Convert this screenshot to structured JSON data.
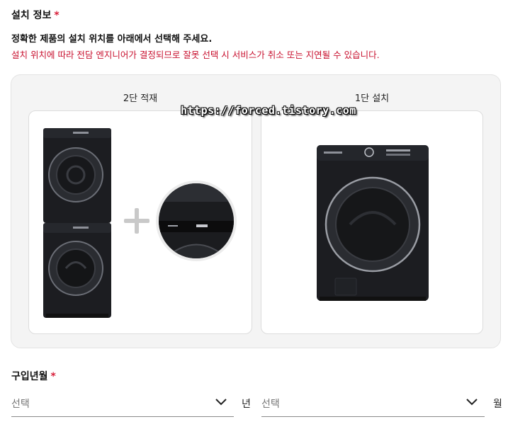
{
  "install": {
    "title": "설치 정보",
    "required_mark": "*",
    "question": "정확한 제품의 설치 위치를 아래에서 선택해 주세요.",
    "warning": "설치 위치에 따라 전담 엔지니어가 결정되므로 잘못 선택 시 서비스가 취소 또는 지연될 수 있습니다.",
    "options": [
      {
        "label": "2단 적재",
        "image": "stacked-washer-dryer-with-stacking-kit"
      },
      {
        "label": "1단 설치",
        "image": "single-front-load-washer"
      }
    ]
  },
  "watermark": "https://forced.tistory.com",
  "purchase": {
    "title": "구입년월",
    "required_mark": "*",
    "year_placeholder": "선택",
    "year_unit": "년",
    "month_placeholder": "선택",
    "month_unit": "월"
  },
  "colors": {
    "accent": "#d81f3a",
    "warning": "#c8102e",
    "panel": "#f4f4f4",
    "appliance": "#1c1d21"
  }
}
